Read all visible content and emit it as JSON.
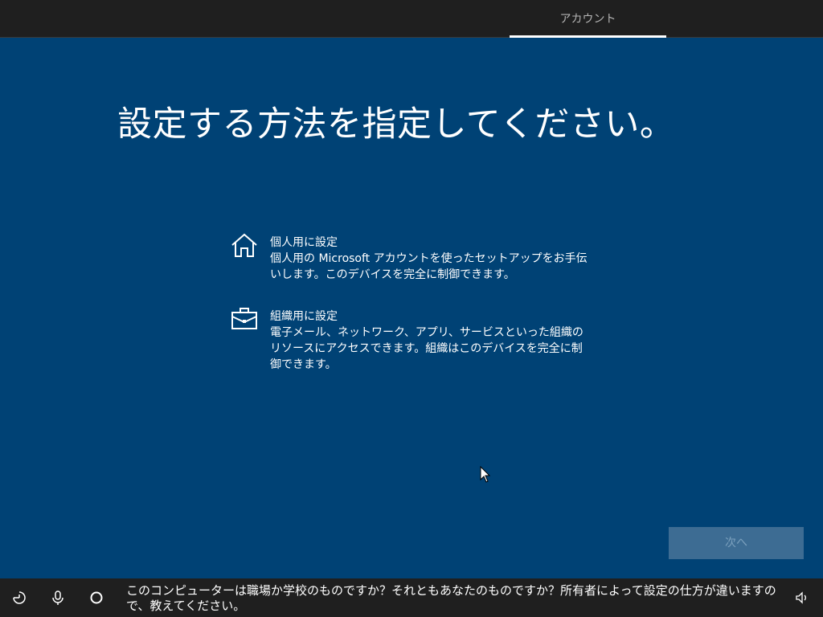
{
  "header": {
    "active_step": "アカウント"
  },
  "main": {
    "title": "設定する方法を指定してください。",
    "options": [
      {
        "icon": "home-icon",
        "label": "個人用に設定",
        "description": "個人用の Microsoft アカウントを使ったセットアップをお手伝いします。このデバイスを完全に制御できます。"
      },
      {
        "icon": "briefcase-icon",
        "label": "組織用に設定",
        "description": "電子メール、ネットワーク、アプリ、サービスといった組織のリソースにアクセスできます。組織はこのデバイスを完全に制御できます。"
      }
    ],
    "next_label": "次へ"
  },
  "footer": {
    "narration": "このコンピューターは職場か学校のものですか？それともあなたのものですか？所有者によって設定の仕方が違いますので、教えてください。",
    "icons": [
      "ease-of-access-icon",
      "microphone-icon",
      "cortana-icon",
      "volume-icon"
    ]
  },
  "colors": {
    "background": "#004275",
    "bar": "#1f1f1f",
    "button_disabled": "#3d6c93"
  }
}
